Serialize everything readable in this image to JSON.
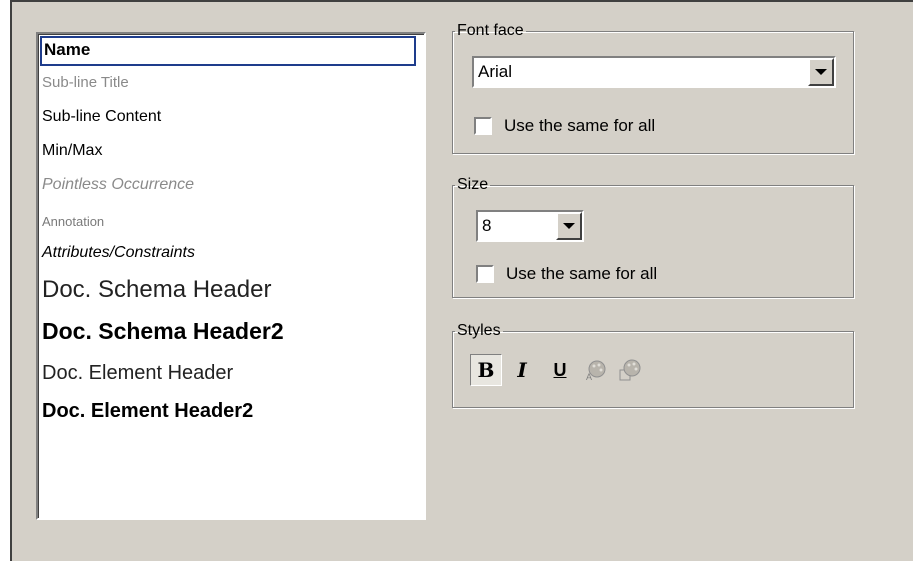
{
  "elements_list": {
    "items": [
      {
        "label": "Name"
      },
      {
        "label": "Sub-line Title"
      },
      {
        "label": "Sub-line Content"
      },
      {
        "label": "Min/Max"
      },
      {
        "label": "Pointless Occurrence"
      },
      {
        "label": "Annotation"
      },
      {
        "label": "Attributes/Constraints"
      },
      {
        "label": "Doc. Schema Header"
      },
      {
        "label": "Doc. Schema Header2"
      },
      {
        "label": "Doc. Element Header"
      },
      {
        "label": "Doc. Element Header2"
      }
    ],
    "selected_index": 0
  },
  "font_face": {
    "legend": "Font face",
    "value": "Arial",
    "same_for_all_label": "Use the same for all",
    "same_for_all_checked": false
  },
  "size": {
    "legend": "Size",
    "value": "8",
    "same_for_all_label": "Use the same for all",
    "same_for_all_checked": false
  },
  "styles": {
    "legend": "Styles",
    "bold_label": "B",
    "italic_label": "I",
    "underline_label": "U",
    "bold_pressed": true
  }
}
